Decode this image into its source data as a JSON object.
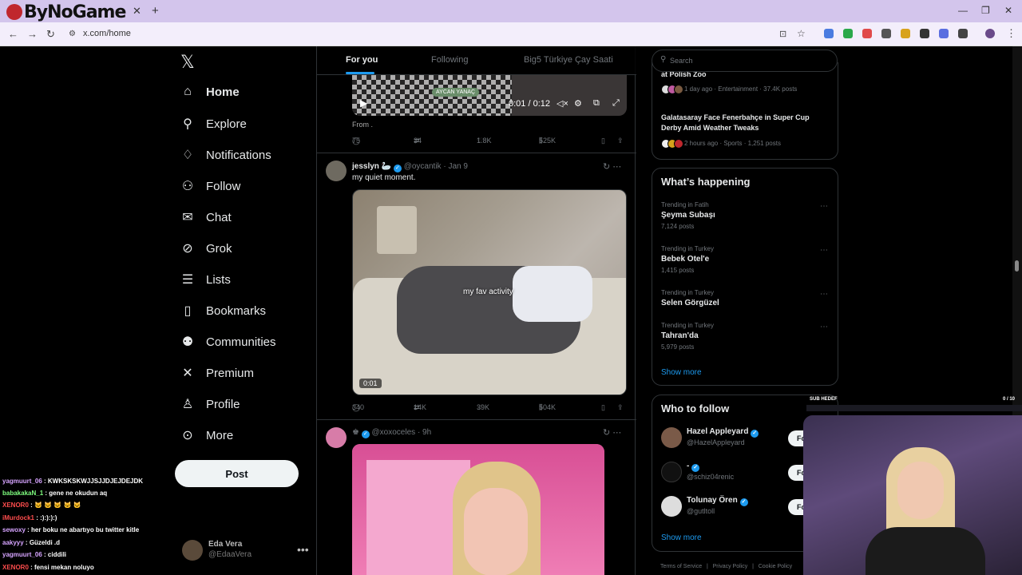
{
  "browser": {
    "logo_text": "ByNoGame",
    "tab_close": "✕",
    "new_tab": "+",
    "url": "x.com/home",
    "window_controls": [
      "—",
      "❐",
      "✕"
    ]
  },
  "sidebar": {
    "items": [
      {
        "label": "Home",
        "icon": "home-icon"
      },
      {
        "label": "Explore",
        "icon": "search-icon"
      },
      {
        "label": "Notifications",
        "icon": "bell-icon"
      },
      {
        "label": "Follow",
        "icon": "add-user-icon"
      },
      {
        "label": "Chat",
        "icon": "mail-icon"
      },
      {
        "label": "Grok",
        "icon": "grok-icon"
      },
      {
        "label": "Lists",
        "icon": "list-icon"
      },
      {
        "label": "Bookmarks",
        "icon": "bookmark-icon"
      },
      {
        "label": "Communities",
        "icon": "people-icon"
      },
      {
        "label": "Premium",
        "icon": "x-icon"
      },
      {
        "label": "Profile",
        "icon": "person-icon"
      },
      {
        "label": "More",
        "icon": "more-circle-icon"
      }
    ],
    "post_button": "Post",
    "account": {
      "name": "Eda Vera",
      "handle": "@EdaaVera"
    }
  },
  "timeline": {
    "tabs": [
      "For you",
      "Following",
      "Big5 Türkiye Çay Saati"
    ],
    "post1": {
      "video_badge": "AYCAN YANAÇ",
      "video_time": "0:01 / 0:12",
      "text": "From .",
      "replies": "75",
      "reposts": "34",
      "likes": "1.8K",
      "views": "525K"
    },
    "post2": {
      "name": "jesslyn 🦢",
      "handle": "@oycantik",
      "date": "Jan 9",
      "text": "my quiet moment.",
      "video_caption": "my fav activity",
      "video_time": "0:01",
      "replies": "340",
      "reposts": "14K",
      "likes": "39K",
      "views": "504K"
    },
    "post3": {
      "name": "",
      "handle": "@xoxoceles",
      "date": "9h"
    }
  },
  "right": {
    "search_placeholder": "Search",
    "news": [
      {
        "title": "at Polish Zoo",
        "meta": "1 day ago · Entertainment · 37.4K posts"
      },
      {
        "title": "Galatasaray Face Fenerbahçe in Super Cup Derby Amid Weather Tweaks",
        "meta": "2 hours ago · Sports · 1,251 posts"
      }
    ],
    "whats_happening": {
      "title": "What’s happening",
      "trends": [
        {
          "context": "Trending in Fatih",
          "name": "Şeyma Subaşı",
          "count": "7,124 posts"
        },
        {
          "context": "Trending in Turkey",
          "name": "Bebek Otel'e",
          "count": "1,415 posts"
        },
        {
          "context": "Trending in Turkey",
          "name": "Selen Görgüzel",
          "count": ""
        },
        {
          "context": "Trending in Turkey",
          "name": "Tahran'da",
          "count": "5,979 posts"
        }
      ],
      "show_more": "Show more"
    },
    "who_to_follow": {
      "title": "Who to follow",
      "users": [
        {
          "name": "Hazel Appleyard",
          "handle": "@HazelAppleyard"
        },
        {
          "name": "-",
          "handle": "@schiz04renic"
        },
        {
          "name": "Tolunay Ören",
          "handle": "@gutltoll"
        }
      ],
      "follow_label": "Fo",
      "show_more": "Show more"
    },
    "footer": [
      "Terms of Service",
      "|",
      "Privacy Policy",
      "|",
      "Cookie Policy"
    ]
  },
  "stream": {
    "sub_label": "SUB HEDEF",
    "sub_count": "0 / 10",
    "chat": [
      {
        "user": "yagmuurt_06",
        "msg": "KWKSKSKWJJSJJDJEJDEJDK",
        "color": "#d6a4ff"
      },
      {
        "user": "babakakaN_1",
        "msg": "gene ne okudun aq",
        "color": "#7fff7f"
      },
      {
        "user": "XENOR0",
        "msg": "🐱 🐱 🐱 🐱 🐱",
        "color": "#ff4d4d"
      },
      {
        "user": "iMurdock1",
        "msg": ":):):):)",
        "color": "#ff4d4d"
      },
      {
        "user": "sewoxy",
        "msg": "her boku ne abartıyo bu twitter kitle",
        "color": "#d6a4ff"
      },
      {
        "user": "aakyyy",
        "msg": "Güzeldi .d",
        "color": "#d6a4ff"
      },
      {
        "user": "yagmuurt_06",
        "msg": "ciddili",
        "color": "#d6a4ff"
      },
      {
        "user": "XENOR0",
        "msg": "fensi mekan noluyo",
        "color": "#ff4d4d"
      }
    ]
  }
}
